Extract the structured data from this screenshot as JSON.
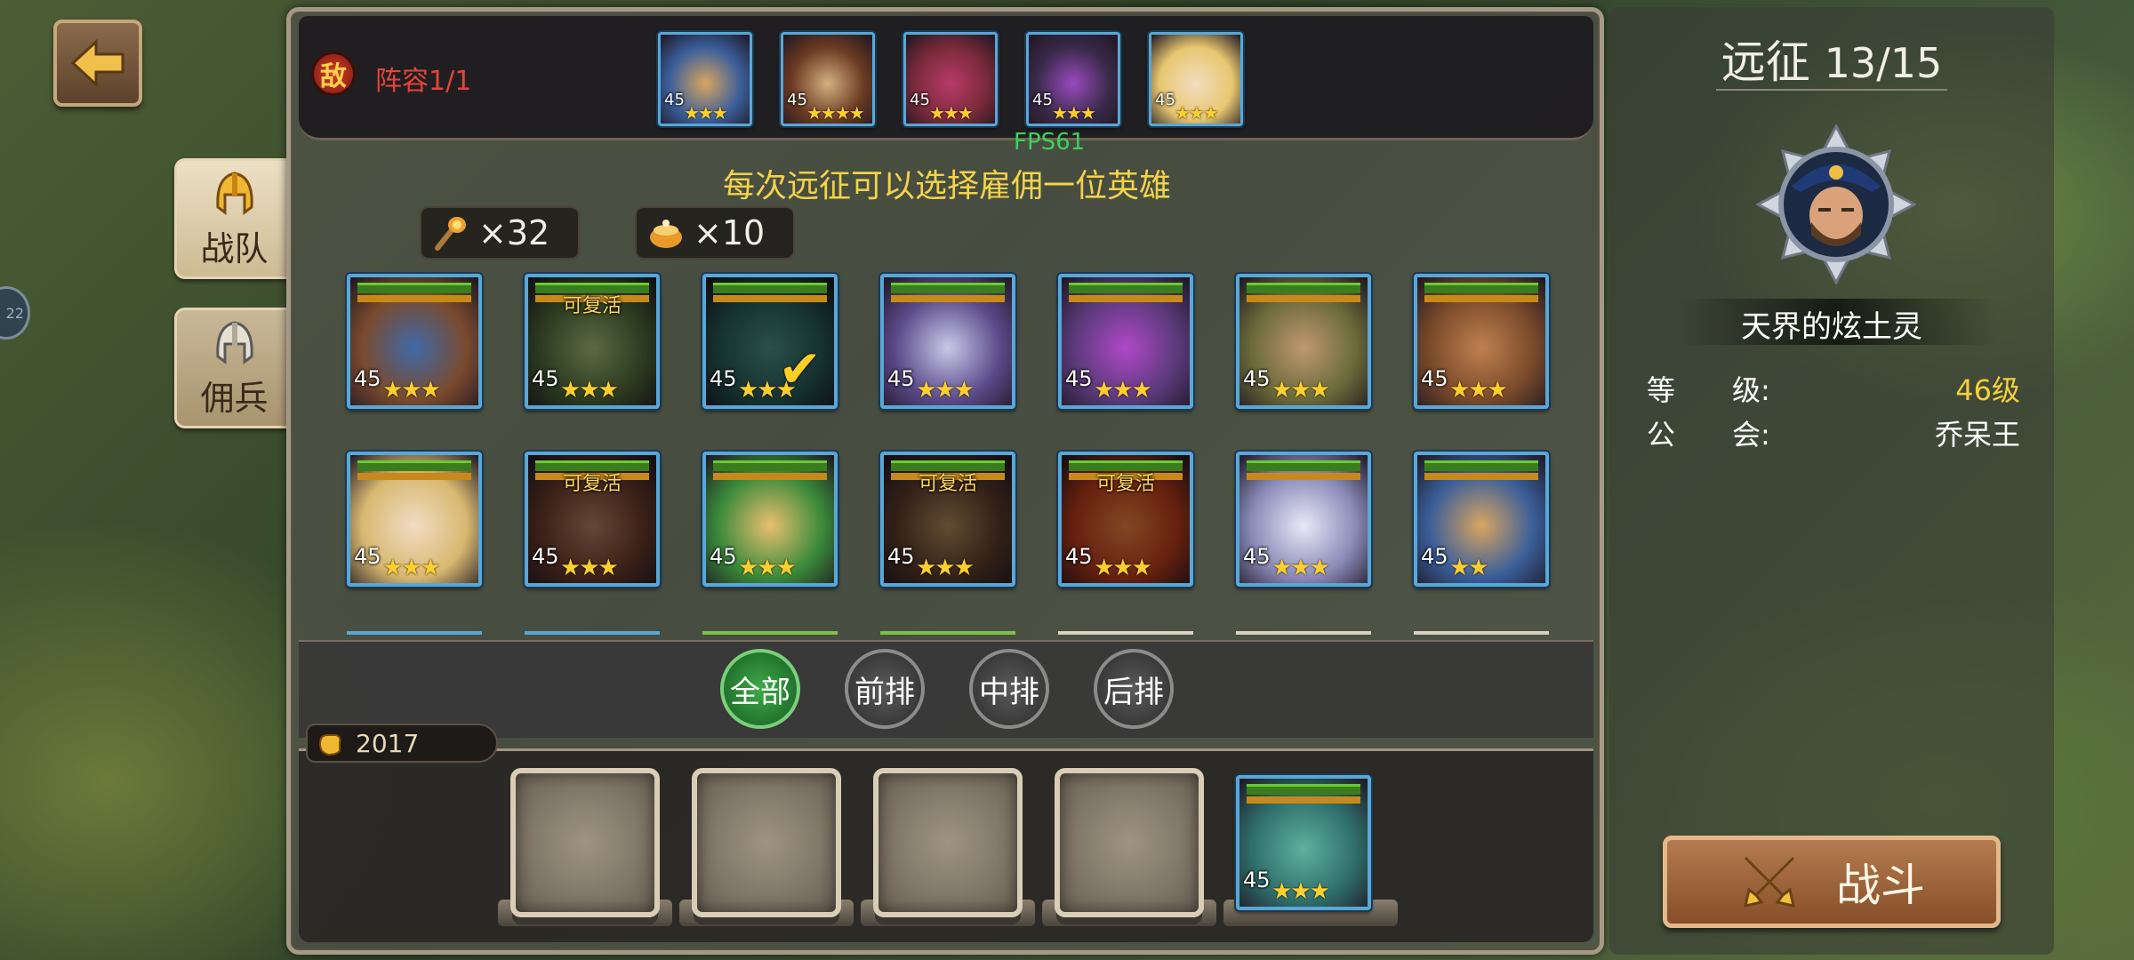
{
  "top": {
    "enemy_badge": "敌",
    "lineup_label": "阵容1/1",
    "fps": "FPS61",
    "enemy_heroes": [
      {
        "level": "45",
        "stars": "★★★",
        "colors": [
          "#3a5e9a",
          "#d8a560"
        ]
      },
      {
        "level": "45",
        "stars": "★★★★",
        "colors": [
          "#6b3a22",
          "#d2b080"
        ]
      },
      {
        "level": "45",
        "stars": "★★★",
        "colors": [
          "#7a2a3a",
          "#b83a6a"
        ]
      },
      {
        "level": "45",
        "stars": "★★★",
        "colors": [
          "#3a2a4a",
          "#9a4ac0"
        ]
      },
      {
        "level": "45",
        "stars": "★★★",
        "colors": [
          "#e8c770",
          "#f3dcc0"
        ]
      }
    ]
  },
  "side_tabs": [
    {
      "label": "战队",
      "active": true
    },
    {
      "label": "佣兵",
      "active": false
    }
  ],
  "hint": "每次远征可以选择雇佣一位英雄",
  "resources": [
    {
      "icon": "torch-icon",
      "label": "×32"
    },
    {
      "icon": "pot-icon",
      "label": "×10"
    }
  ],
  "roster_row1": [
    {
      "level": "45",
      "stars": "★★★",
      "revive": "",
      "selected": false,
      "colors": [
        "#7a4a2e",
        "#3e6aa8"
      ]
    },
    {
      "level": "45",
      "stars": "★★★",
      "revive": "可复活",
      "selected": false,
      "colors": [
        "#4f6a3a",
        "#a6c07a"
      ]
    },
    {
      "level": "45",
      "stars": "★★★",
      "revive": "",
      "selected": true,
      "colors": [
        "#2f6e6a",
        "#5eb0a0"
      ]
    },
    {
      "level": "45",
      "stars": "★★★",
      "revive": "",
      "selected": false,
      "colors": [
        "#5a4a8a",
        "#c8c8e8"
      ]
    },
    {
      "level": "45",
      "stars": "★★★",
      "revive": "",
      "selected": false,
      "colors": [
        "#5a3a7a",
        "#b048c8"
      ]
    },
    {
      "level": "45",
      "stars": "★★★",
      "revive": "",
      "selected": false,
      "colors": [
        "#6a6a3a",
        "#c09870"
      ]
    },
    {
      "level": "45",
      "stars": "★★★",
      "revive": "",
      "selected": false,
      "colors": [
        "#7a4a2a",
        "#c08050"
      ]
    }
  ],
  "roster_row2": [
    {
      "level": "45",
      "stars": "★★★",
      "revive": "",
      "selected": false,
      "colors": [
        "#d8b870",
        "#f2dcc4"
      ]
    },
    {
      "level": "45",
      "stars": "★★★",
      "revive": "可复活",
      "selected": false,
      "colors": [
        "#6a3a2a",
        "#b88060"
      ]
    },
    {
      "level": "45",
      "stars": "★★★",
      "revive": "",
      "selected": false,
      "colors": [
        "#3a8a3a",
        "#e8c070"
      ]
    },
    {
      "level": "45",
      "stars": "★★★",
      "revive": "可复活",
      "selected": false,
      "colors": [
        "#5a3a2a",
        "#b08a5a"
      ]
    },
    {
      "level": "45",
      "stars": "★★★",
      "revive": "可复活",
      "selected": false,
      "colors": [
        "#b83a1a",
        "#f08040"
      ]
    },
    {
      "level": "45",
      "stars": "★★★",
      "revive": "",
      "selected": false,
      "colors": [
        "#8a8ab8",
        "#e8e8f8"
      ]
    },
    {
      "level": "45",
      "stars": "★★",
      "revive": "",
      "selected": false,
      "colors": [
        "#3a5e9a",
        "#d8a560"
      ]
    }
  ],
  "filters": [
    {
      "label": "全部",
      "active": true
    },
    {
      "label": "前排",
      "active": false
    },
    {
      "label": "中排",
      "active": false
    },
    {
      "label": "后排",
      "active": false
    }
  ],
  "power": "2017",
  "lineup_slot5": {
    "level": "45",
    "stars": "★★★",
    "colors": [
      "#2f6e6a",
      "#5eb0a0"
    ]
  },
  "right": {
    "title_word": "远征",
    "title_progress": "13/15",
    "player_name": "天界的炫土灵",
    "level_key1": "等",
    "level_key2": "级:",
    "level_value": "46级",
    "guild_key1": "公",
    "guild_key2": "会:",
    "guild_value": "乔呆王",
    "fight_label": "战斗"
  },
  "left_bubble": "22"
}
